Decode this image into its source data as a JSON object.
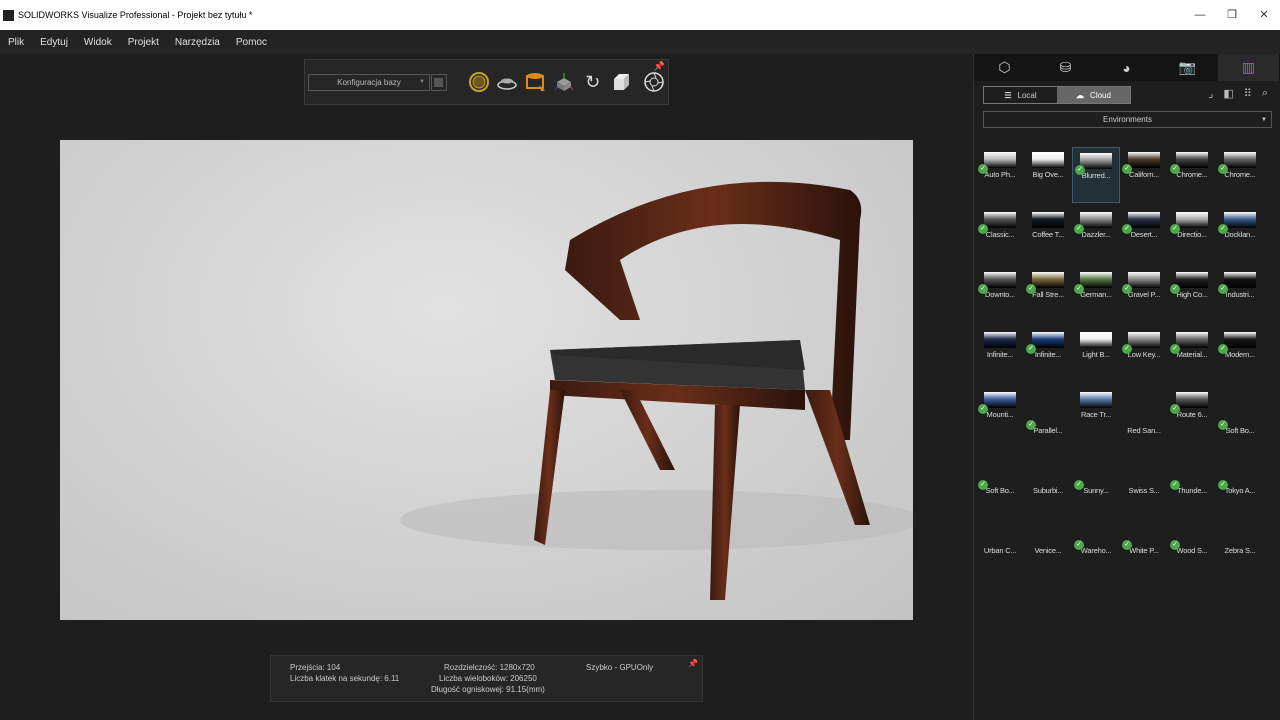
{
  "window": {
    "title": "SOLIDWORKS Visualize Professional - Projekt bez tytułu *",
    "minimize": "—",
    "restore": "❐",
    "close": "✕"
  },
  "menu": [
    "Plik",
    "Edytuj",
    "Widok",
    "Projekt",
    "Narzędzia",
    "Pomoc"
  ],
  "toolbar": {
    "config": "Konfiguracja bazy"
  },
  "status": {
    "passes": "Przejścia: 104",
    "fps": "Liczba klatek na sekundę: 6.11",
    "resolution": "Rozdzielczość: 1280x720",
    "polygons": "Liczba wieloboków: 206250",
    "focal": "Długość ogniskowej: 91.15(mm)",
    "mode": "Szybko - GPUOnly"
  },
  "panel": {
    "local": "Local",
    "cloud": "Cloud",
    "category": "Environments",
    "items": [
      {
        "label": "Auto Ph...",
        "check": true,
        "thumb": "#bbb"
      },
      {
        "label": "Big Ove...",
        "check": false,
        "thumb": "#eee"
      },
      {
        "label": "Blurred...",
        "check": true,
        "thumb": "#999",
        "selected": true
      },
      {
        "label": "Californ...",
        "check": true,
        "thumb": "#4a3a2a"
      },
      {
        "label": "Chrome...",
        "check": true,
        "thumb": "#444"
      },
      {
        "label": "Chrome...",
        "check": true,
        "thumb": "#666"
      },
      {
        "label": "Classic...",
        "check": true,
        "thumb": "#555"
      },
      {
        "label": "Coffee T...",
        "check": false,
        "thumb": "#151a22"
      },
      {
        "label": "Dazzler...",
        "check": true,
        "thumb": "#888"
      },
      {
        "label": "Desert...",
        "check": true,
        "thumb": "#2a3548"
      },
      {
        "label": "Directio...",
        "check": true,
        "thumb": "#aaa"
      },
      {
        "label": "Docklan...",
        "check": true,
        "thumb": "#3a5a8a"
      },
      {
        "label": "Downto...",
        "check": true,
        "thumb": "#555"
      },
      {
        "label": "Fall Stre...",
        "check": true,
        "thumb": "#7a6a3a"
      },
      {
        "label": "German...",
        "check": true,
        "thumb": "#5a7a4a"
      },
      {
        "label": "Gravel P...",
        "check": true,
        "thumb": "#8a8a8a"
      },
      {
        "label": "High Co...",
        "check": true,
        "thumb": "#222"
      },
      {
        "label": "Industri...",
        "check": true,
        "thumb": "#111"
      },
      {
        "label": "Infinite...",
        "check": false,
        "thumb": "#1a2a4a"
      },
      {
        "label": "Infinite...",
        "check": true,
        "thumb": "#1a3a7a"
      },
      {
        "label": "Light B...",
        "check": false,
        "thumb": "#eee"
      },
      {
        "label": "Low Key...",
        "check": true,
        "thumb": "#888"
      },
      {
        "label": "Material...",
        "check": true,
        "thumb": "#666"
      },
      {
        "label": "Modern...",
        "check": true,
        "thumb": "#1a1a1a"
      },
      {
        "label": "Mounti...",
        "check": true,
        "thumb": "#3a5a9a"
      },
      {
        "label": "Parallel...",
        "check": true
      },
      {
        "label": "Race Tr...",
        "check": false,
        "thumb": "#5a7aaa"
      },
      {
        "label": "Red San...",
        "check": false
      },
      {
        "label": "Route 6...",
        "check": true,
        "thumb": "#555"
      },
      {
        "label": "Soft Bo...",
        "check": true
      },
      {
        "label": "Soft Bo...",
        "check": true
      },
      {
        "label": "Suburbi...",
        "check": false
      },
      {
        "label": "Sunny...",
        "check": true
      },
      {
        "label": "Swiss S...",
        "check": false
      },
      {
        "label": "Thunde...",
        "check": true
      },
      {
        "label": "Tokyo A...",
        "check": true
      },
      {
        "label": "Urban C...",
        "check": false
      },
      {
        "label": "Venice...",
        "check": false
      },
      {
        "label": "Wareho...",
        "check": true
      },
      {
        "label": "White P...",
        "check": true
      },
      {
        "label": "Wood S...",
        "check": true
      },
      {
        "label": "Zebra S...",
        "check": false
      }
    ]
  }
}
